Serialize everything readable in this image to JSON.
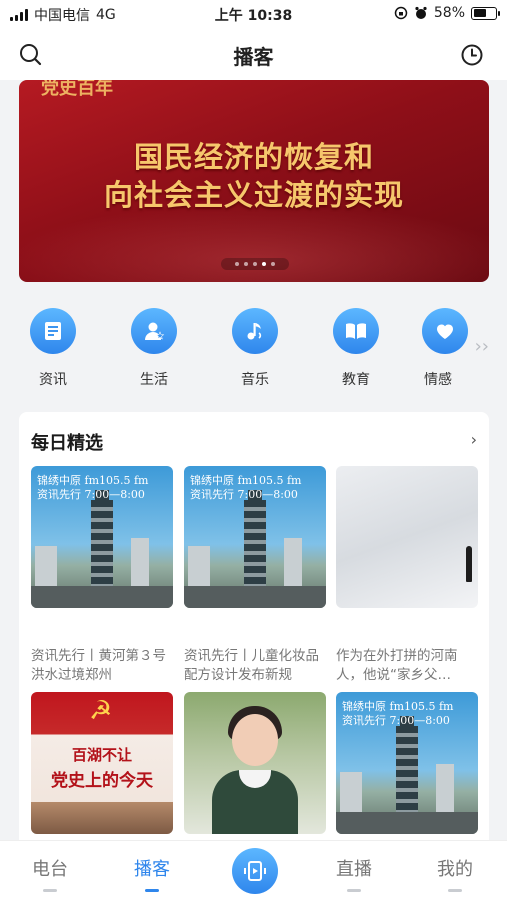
{
  "status_bar": {
    "carrier": "中国电信",
    "network": "4G",
    "time": "上午 10:38",
    "battery_text": "58%",
    "battery_level": 0.58
  },
  "header": {
    "title": "播客",
    "left_icon": "search-icon",
    "right_icon": "history-clock-icon"
  },
  "banner": {
    "headline_line1": "国民经济的恢复和",
    "headline_line2": "向社会主义过渡的实现",
    "logo_text": "党史百年",
    "page_count": 5,
    "active_page": 4
  },
  "categories": [
    {
      "label": "资讯",
      "icon": "news-icon"
    },
    {
      "label": "生活",
      "icon": "person-star-icon"
    },
    {
      "label": "音乐",
      "icon": "music-note-icon"
    },
    {
      "label": "教育",
      "icon": "book-icon"
    },
    {
      "label": "情感",
      "icon": "heart-chat-icon"
    }
  ],
  "categories_more_icon": "double-chevron-right-icon",
  "daily": {
    "title": "每日精选",
    "more_icon": "chevron-right-icon",
    "thumb_caption_line1": "锦绣中原",
    "thumb_caption_line2": "资讯先行",
    "thumb_freq": "fm105.5 fm",
    "thumb_time": "7:00—8:00",
    "party_text_line1": "百湖不让",
    "party_text_line2": "党史上的今天",
    "items": [
      {
        "title": "资讯先行丨黄河第３号洪水过境郑州",
        "thumb": "city"
      },
      {
        "title": "资讯先行丨儿童化妆品配方设计发布新规",
        "thumb": "city"
      },
      {
        "title": "作为在外打拼的河南人，他说“家乡父…",
        "thumb": "snow"
      },
      {
        "title": "",
        "thumb": "party"
      },
      {
        "title": "",
        "thumb": "girl"
      },
      {
        "title": "",
        "thumb": "city"
      }
    ]
  },
  "tabbar": {
    "tabs": [
      "电台",
      "播客",
      "直播",
      "我的"
    ],
    "active_index": 1,
    "center_icon": "play-center-icon"
  }
}
